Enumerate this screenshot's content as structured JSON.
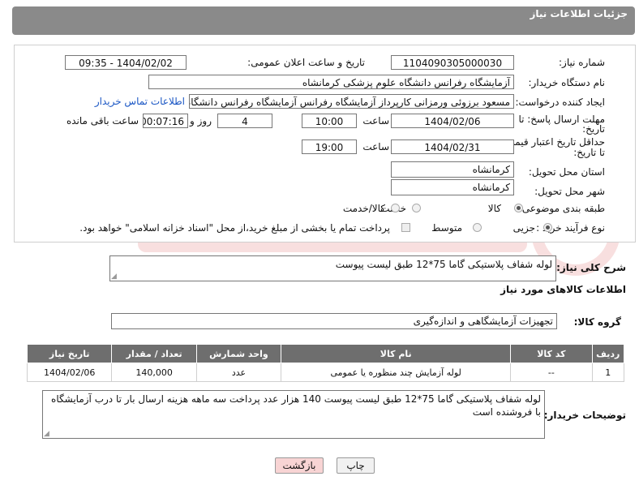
{
  "header": {
    "title": "جزئیات اطلاعات نیاز"
  },
  "form": {
    "need_number": {
      "label": "شماره نیاز:",
      "value": "1104090305000030"
    },
    "announce": {
      "label": "تاریخ و ساعت اعلان عمومی:",
      "value": "1404/02/02 - 09:35"
    },
    "buyer_org": {
      "label": "نام دستگاه خریدار:",
      "value": "آزمایشگاه رفرانس دانشگاه علوم پزشکی کرمانشاه"
    },
    "requester": {
      "label": "ایجاد کننده درخواست:",
      "value": "مسعود برزوئی ورمزانی کارپرداز آزمایشگاه رفرانس آزمایشگاه رفرانس دانشگاه ع",
      "contact_link": "اطلاعات تماس خریدار"
    },
    "deadline": {
      "label_line1": "مهلت ارسال پاسخ: تا",
      "label_line2": "تاریخ:",
      "date": "1404/02/06",
      "time_label": "ساعت",
      "time": "10:00",
      "days": "4",
      "days_label": "روز و",
      "remaining": "00:07:16",
      "remaining_label": "ساعت باقی مانده"
    },
    "price_validity": {
      "label_line1": "حداقل تاریخ اعتبار قیمت:",
      "label_line2": "تا تاریخ:",
      "date": "1404/02/31",
      "time_label": "ساعت",
      "time": "19:00"
    },
    "province": {
      "label": "استان محل تحویل:",
      "value": "کرمانشاه"
    },
    "city": {
      "label": "شهر محل تحویل:",
      "value": "کرمانشاه"
    },
    "category": {
      "label": "طبقه بندی موضوعی:",
      "options": [
        "کالا",
        "خدمت",
        "کالا/خدمت"
      ],
      "selected": "کالا"
    },
    "purchase_type": {
      "label": "نوع فرآیند خرید :",
      "options": [
        "جزیی",
        "متوسط"
      ],
      "selected": "جزیی",
      "note": "پرداخت تمام یا بخشی از مبلغ خرید،از محل \"اسناد خزانه اسلامی\" خواهد بود."
    }
  },
  "description": {
    "label": "شرح کلی نیاز:",
    "value": "لوله شفاف پلاستیکی گاما 75*12 طبق لیست پیوست"
  },
  "goods_section": {
    "title": "اطلاعات کالاهای مورد نیاز"
  },
  "goods_group": {
    "label": "گروه کالا:",
    "value": "تجهیزات آزمایشگاهی و اندازه‌گیری"
  },
  "table": {
    "headers": [
      "ردیف",
      "کد کالا",
      "نام کالا",
      "واحد شمارش",
      "تعداد / مقدار",
      "تاریخ نیاز"
    ],
    "rows": [
      [
        "1",
        "--",
        "لوله آزمایش چند منظوره یا عمومی",
        "عدد",
        "140,000",
        "1404/02/06"
      ]
    ]
  },
  "buyer_notes": {
    "label": "توضیحات خریدار:",
    "value": "لوله شفاف پلاستیکی گاما 75*12 طبق لیست پیوست 140 هزار عدد پرداخت سه ماهه هزینه ارسال بار تا درب آزمایشگاه با فروشنده است"
  },
  "buttons": {
    "print": "چاپ",
    "back": "بازگشت"
  },
  "colors": {
    "header_bg": "#8a8a8a",
    "table_header_bg": "#6e6e6e",
    "link": "#1a56c4",
    "back_button_bg": "#f8d4d4"
  }
}
